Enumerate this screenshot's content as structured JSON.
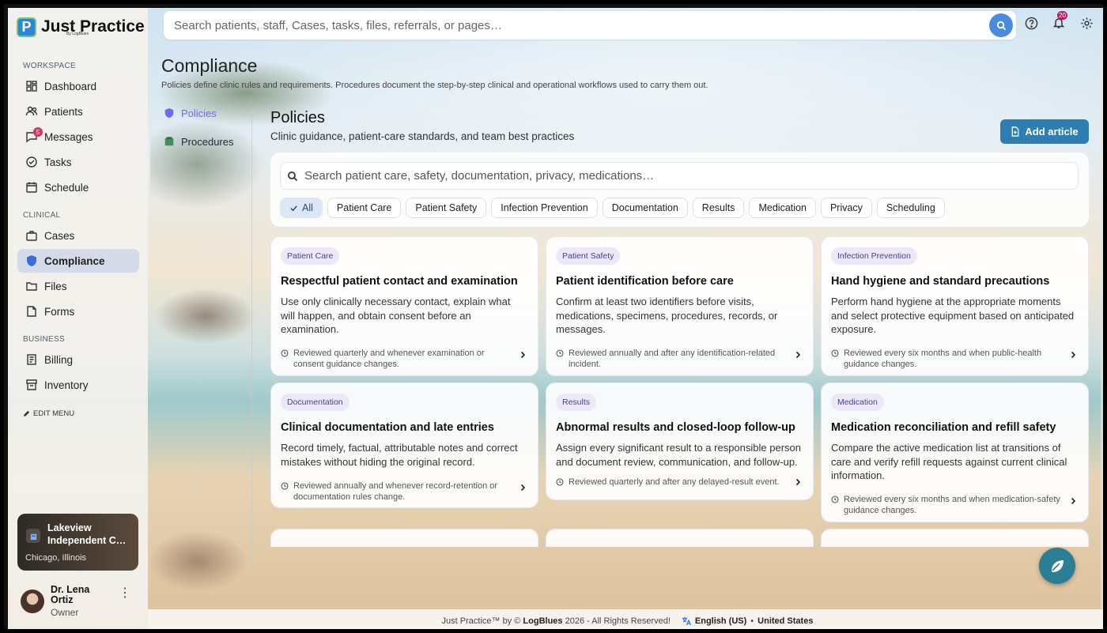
{
  "app": {
    "name": "Just Practice",
    "byline": "By LogBlues",
    "logo_letter": "P"
  },
  "topbar": {
    "search_placeholder": "Search patients, staff, Cases, tasks, files, referrals, or pages…",
    "notifications_count": "20"
  },
  "sidebar": {
    "sections": [
      {
        "label": "WORKSPACE",
        "items": [
          {
            "label": "Dashboard",
            "icon": "dashboard-icon"
          },
          {
            "label": "Patients",
            "icon": "patients-icon"
          },
          {
            "label": "Messages",
            "icon": "messages-icon",
            "badge": "5"
          },
          {
            "label": "Tasks",
            "icon": "tasks-icon"
          },
          {
            "label": "Schedule",
            "icon": "calendar-icon"
          }
        ]
      },
      {
        "label": "CLINICAL",
        "items": [
          {
            "label": "Cases",
            "icon": "briefcase-icon"
          },
          {
            "label": "Compliance",
            "icon": "shield-icon",
            "active": true
          },
          {
            "label": "Files",
            "icon": "folder-icon"
          },
          {
            "label": "Forms",
            "icon": "forms-icon"
          }
        ]
      },
      {
        "label": "BUSINESS",
        "items": [
          {
            "label": "Billing",
            "icon": "billing-icon"
          },
          {
            "label": "Inventory",
            "icon": "inventory-icon"
          }
        ]
      }
    ],
    "edit_menu": "EDIT MENU",
    "clinic": {
      "name": "Lakeview Independent C…",
      "name_line1": "Lakeview",
      "name_line2": "Independent C…",
      "location": "Chicago, Illinois"
    },
    "user": {
      "name_line1": "Dr. Lena",
      "name_line2": "Ortiz",
      "role": "Owner"
    }
  },
  "page": {
    "title": "Compliance",
    "subtitle": "Policies define clinic rules and requirements. Procedures document the step-by-step clinical and operational workflows used to carry them out.",
    "subnav": [
      {
        "label": "Policies",
        "active": true
      },
      {
        "label": "Procedures"
      }
    ]
  },
  "policies": {
    "title": "Policies",
    "subtitle": "Clinic guidance, patient-care standards, and team best practices",
    "add_button": "Add article",
    "search_placeholder": "Search patient care, safety, documentation, privacy, medications…",
    "filters": [
      "All",
      "Patient Care",
      "Patient Safety",
      "Infection Prevention",
      "Documentation",
      "Results",
      "Medication",
      "Privacy",
      "Scheduling"
    ],
    "active_filter": "All",
    "cards": [
      {
        "tag": "Patient Care",
        "title": "Respectful patient contact and examination",
        "description": "Use only clinically necessary contact, explain what will happen, and obtain consent before an examination.",
        "review": "Reviewed quarterly and whenever examination or consent guidance changes."
      },
      {
        "tag": "Patient Safety",
        "title": "Patient identification before care",
        "description": "Confirm at least two identifiers before visits, medications, specimens, procedures, records, or messages.",
        "review": "Reviewed annually and after any identification-related incident."
      },
      {
        "tag": "Infection Prevention",
        "title": "Hand hygiene and standard precautions",
        "description": "Perform hand hygiene at the appropriate moments and select protective equipment based on anticipated exposure.",
        "review": "Reviewed every six months and when public-health guidance changes."
      },
      {
        "tag": "Documentation",
        "title": "Clinical documentation and late entries",
        "description": "Record timely, factual, attributable notes and correct mistakes without hiding the original record.",
        "review": "Reviewed annually and whenever record-retention or documentation rules change."
      },
      {
        "tag": "Results",
        "title": "Abnormal results and closed-loop follow-up",
        "description": "Assign every significant result to a responsible person and document review, communication, and follow-up.",
        "review": "Reviewed quarterly and after any delayed-result event."
      },
      {
        "tag": "Medication",
        "title": "Medication reconciliation and refill safety",
        "description": "Compare the active medication list at transitions of care and verify refill requests against current clinical information.",
        "review": "Reviewed every six months and when medication-safety guidance changes."
      }
    ]
  },
  "footer": {
    "copyright_prefix": "Just Practice™ by ©",
    "brand": "LogBlues",
    "copyright_suffix": "2026 - All Rights Reserved!",
    "language": "English (US)",
    "region": "United States"
  },
  "colors": {
    "accent": "#2d7fb3",
    "active_nav": "#cdd5e8",
    "badge": "#d6336c",
    "fab": "#2a7f95"
  }
}
